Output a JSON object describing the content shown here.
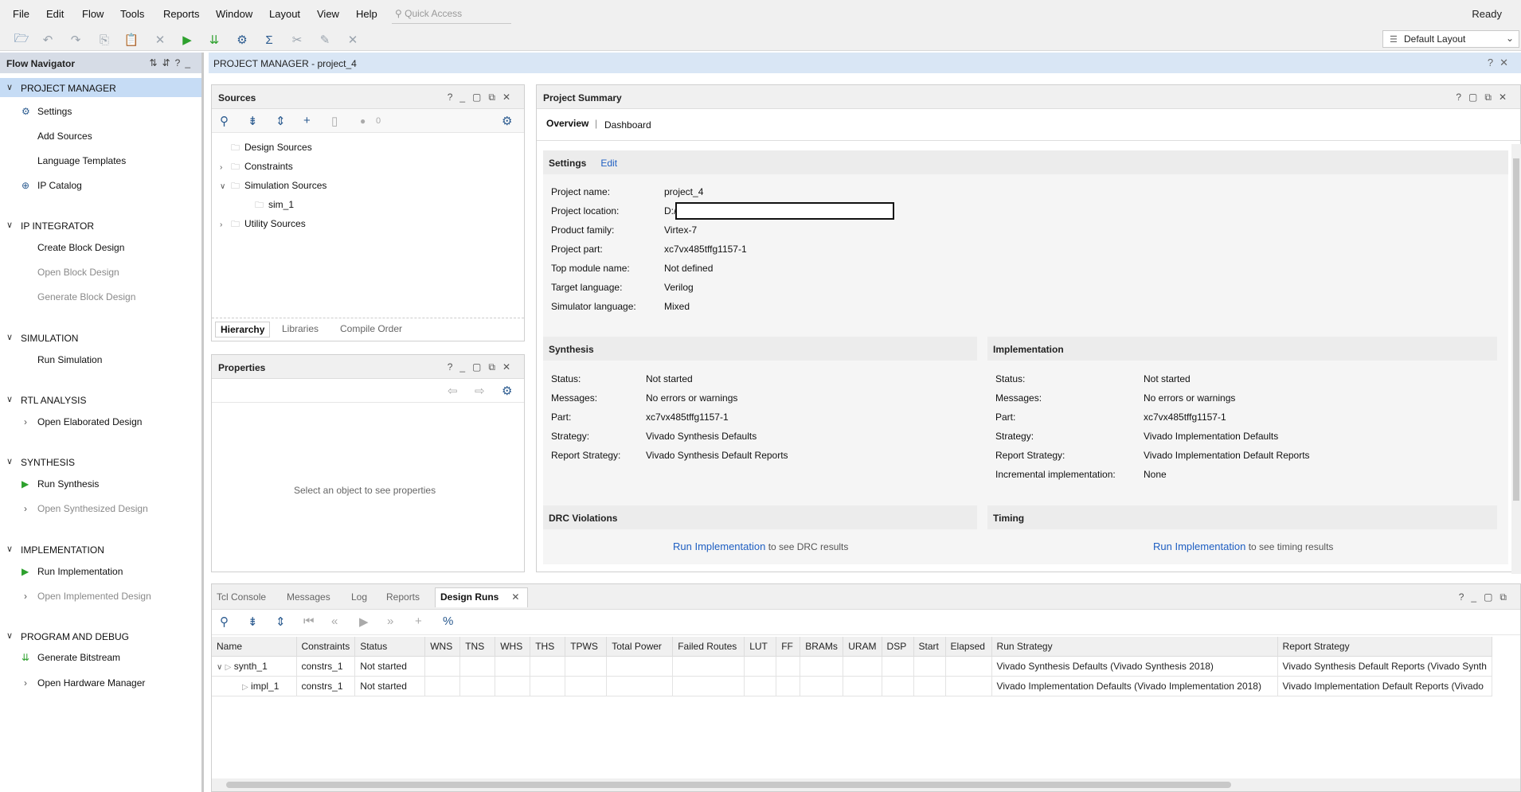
{
  "menu": {
    "items": [
      "File",
      "Edit",
      "Flow",
      "Tools",
      "Reports",
      "Window",
      "Layout",
      "View",
      "Help"
    ],
    "quick_access_placeholder": "Quick Access",
    "status": "Ready"
  },
  "toolbar": {
    "layout_select": "Default Layout"
  },
  "flow_navigator": {
    "title": "Flow Navigator",
    "sections": [
      {
        "label": "PROJECT MANAGER",
        "items": [
          {
            "label": "Settings"
          },
          {
            "label": "Add Sources"
          },
          {
            "label": "Language Templates"
          },
          {
            "label": "IP Catalog"
          }
        ]
      },
      {
        "label": "IP INTEGRATOR",
        "items": [
          {
            "label": "Create Block Design"
          },
          {
            "label": "Open Block Design"
          },
          {
            "label": "Generate Block Design"
          }
        ]
      },
      {
        "label": "SIMULATION",
        "items": [
          {
            "label": "Run Simulation"
          }
        ]
      },
      {
        "label": "RTL ANALYSIS",
        "items": [
          {
            "label": "Open Elaborated Design"
          }
        ]
      },
      {
        "label": "SYNTHESIS",
        "items": [
          {
            "label": "Run Synthesis"
          },
          {
            "label": "Open Synthesized Design"
          }
        ]
      },
      {
        "label": "IMPLEMENTATION",
        "items": [
          {
            "label": "Run Implementation"
          },
          {
            "label": "Open Implemented Design"
          }
        ]
      },
      {
        "label": "PROGRAM AND DEBUG",
        "items": [
          {
            "label": "Generate Bitstream"
          },
          {
            "label": "Open Hardware Manager"
          }
        ]
      }
    ]
  },
  "main_header": "PROJECT MANAGER - project_4",
  "sources": {
    "title": "Sources",
    "count": "0",
    "tree": [
      "Design Sources",
      "Constraints",
      "Simulation Sources",
      "sim_1",
      "Utility Sources"
    ],
    "tabs": [
      "Hierarchy",
      "Libraries",
      "Compile Order"
    ]
  },
  "properties": {
    "title": "Properties",
    "empty_text": "Select an object to see properties"
  },
  "summary": {
    "title": "Project Summary",
    "tabs": [
      "Overview",
      "Dashboard"
    ],
    "settings_title": "Settings",
    "edit": "Edit",
    "rows": [
      {
        "label": "Project name:",
        "value": "project_4"
      },
      {
        "label": "Project location:",
        "value": "D:/"
      },
      {
        "label": "Product family:",
        "value": "Virtex-7"
      },
      {
        "label": "Project part:",
        "value": "xc7vx485tffg1157-1"
      },
      {
        "label": "Top module name:",
        "value": "Not defined"
      },
      {
        "label": "Target language:",
        "value": "Verilog"
      },
      {
        "label": "Simulator language:",
        "value": "Mixed"
      }
    ],
    "synthesis": {
      "title": "Synthesis",
      "rows": [
        {
          "label": "Status:",
          "value": "Not started"
        },
        {
          "label": "Messages:",
          "value": "No errors or warnings"
        },
        {
          "label": "Part:",
          "value": "xc7vx485tffg1157-1"
        },
        {
          "label": "Strategy:",
          "value": "Vivado Synthesis Defaults"
        },
        {
          "label": "Report Strategy:",
          "value": "Vivado Synthesis Default Reports"
        }
      ]
    },
    "implementation": {
      "title": "Implementation",
      "rows": [
        {
          "label": "Status:",
          "value": "Not started"
        },
        {
          "label": "Messages:",
          "value": "No errors or warnings"
        },
        {
          "label": "Part:",
          "value": "xc7vx485tffg1157-1"
        },
        {
          "label": "Strategy:",
          "value": "Vivado Implementation Defaults"
        },
        {
          "label": "Report Strategy:",
          "value": "Vivado Implementation Default Reports"
        },
        {
          "label": "Incremental implementation:",
          "value": "None"
        }
      ]
    },
    "drc": {
      "title": "DRC Violations",
      "link": "Run Implementation",
      "text": "to see DRC results"
    },
    "timing": {
      "title": "Timing",
      "link": "Run Implementation",
      "text": "to see timing results"
    }
  },
  "bottom": {
    "tabs": [
      "Tcl Console",
      "Messages",
      "Log",
      "Reports",
      "Design Runs"
    ],
    "columns": [
      "Name",
      "Constraints",
      "Status",
      "WNS",
      "TNS",
      "WHS",
      "THS",
      "TPWS",
      "Total Power",
      "Failed Routes",
      "LUT",
      "FF",
      "BRAMs",
      "URAM",
      "DSP",
      "Start",
      "Elapsed",
      "Run Strategy",
      "Report Strategy"
    ],
    "rows": [
      {
        "name": "synth_1",
        "constraints": "constrs_1",
        "status": "Not started",
        "run_strategy": "Vivado Synthesis Defaults (Vivado Synthesis 2018)",
        "report_strategy": "Vivado Synthesis Default Reports (Vivado Synth"
      },
      {
        "name": "impl_1",
        "constraints": "constrs_1",
        "status": "Not started",
        "run_strategy": "Vivado Implementation Defaults (Vivado Implementation 2018)",
        "report_strategy": "Vivado Implementation Default Reports (Vivado"
      }
    ]
  }
}
